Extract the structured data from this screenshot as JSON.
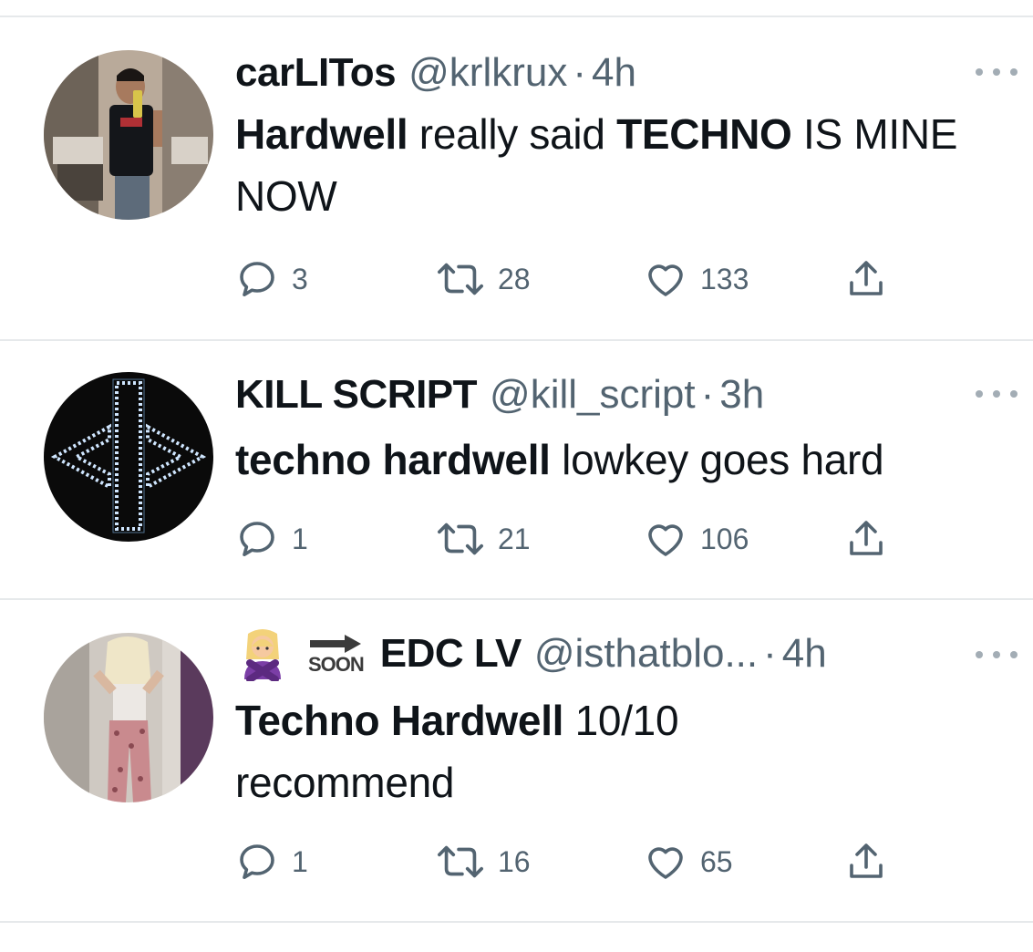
{
  "tweets": [
    {
      "display_name": "carLITos",
      "handle": "@krlkrux",
      "separator": "·",
      "time": "4h",
      "text_parts": [
        {
          "text": "Hardwell",
          "bold": true
        },
        {
          "text": " really said ",
          "bold": false
        },
        {
          "text": "TECHNO",
          "bold": true
        },
        {
          "text": " IS MINE NOW",
          "bold": false
        }
      ],
      "replies": "3",
      "retweets": "28",
      "likes": "133",
      "avatar_icon": "person-selfie-photo"
    },
    {
      "display_name": "KILL SCRIPT",
      "handle": "@kill_script",
      "separator": "·",
      "time": "3h",
      "text_parts": [
        {
          "text": "techno hardwell",
          "bold": true
        },
        {
          "text": " lowkey goes hard",
          "bold": false
        }
      ],
      "replies": "1",
      "retweets": "21",
      "likes": "106",
      "avatar_icon": "neon-arrows-logo"
    },
    {
      "display_name": "EDC LV",
      "handle": "@isthatblo...",
      "separator": "·",
      "time": "4h",
      "name_emojis": [
        "person-gesturing-no-emoji",
        "soon-arrow-emoji"
      ],
      "soon_label": "SOON",
      "text_parts": [
        {
          "text": "Techno Hardwell",
          "bold": true
        },
        {
          "text": " 10/10",
          "bold": false
        },
        {
          "text": " recommend",
          "bold": false
        }
      ],
      "replies": "1",
      "retweets": "16",
      "likes": "65",
      "avatar_icon": "person-back-photo"
    }
  ],
  "colors": {
    "text": "#0f1419",
    "secondary": "#536471",
    "divider": "#e6e9eb"
  }
}
